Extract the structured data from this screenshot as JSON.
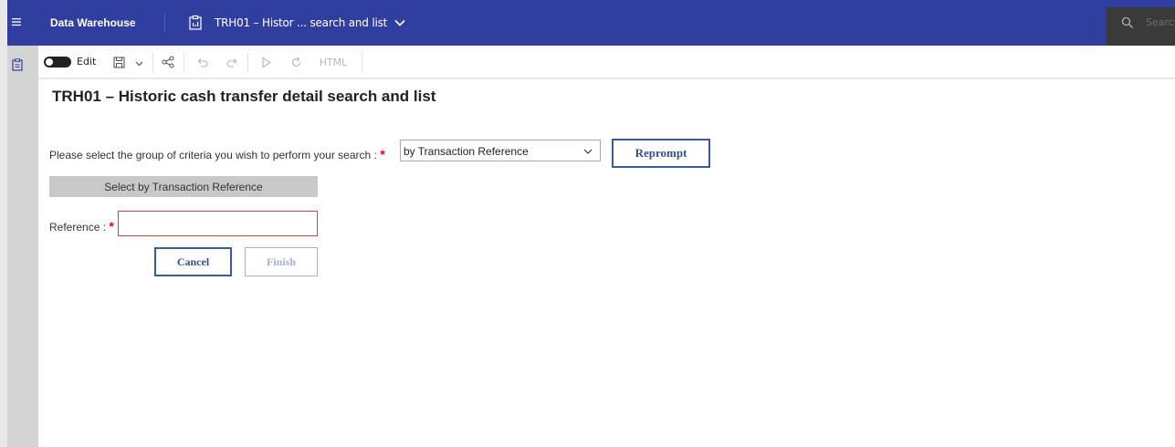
{
  "header": {
    "app_name": "Data Warehouse",
    "report_tab": "TRH01 – Histor ... search and list",
    "search_placeholder": "Search"
  },
  "toolbar": {
    "edit_label": "Edit",
    "html_label": "HTML"
  },
  "page": {
    "title": "TRH01 – Historic cash transfer detail search and list"
  },
  "form": {
    "criteria_label": "Please select the group of criteria you wish to perform your search :",
    "required_mark": "*",
    "criteria_selected": "by Transaction Reference",
    "reprompt_label": "Reprompt",
    "section_title": "Select by Transaction Reference",
    "reference_label": "Reference :",
    "reference_value": "",
    "cancel_label": "Cancel",
    "finish_label": "Finish"
  },
  "colors": {
    "topbar": "#303f9f",
    "button_border": "#3a5a9c",
    "required": "#ee0000"
  }
}
